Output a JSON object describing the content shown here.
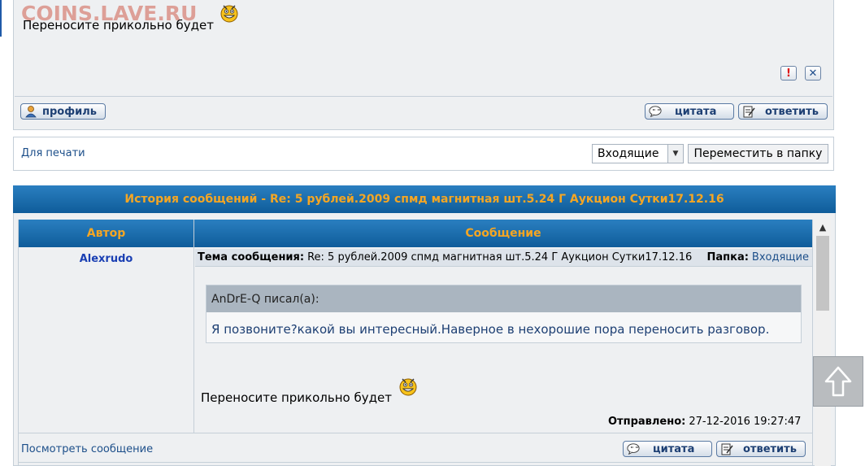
{
  "watermark": "COINS.LAVE.RU",
  "top_post": {
    "text": "Переносите прикольно будет",
    "smiley_icon": "grinning-smiley-icon",
    "report_label": "!",
    "delete_label": "✕",
    "profile_label": "профиль",
    "quote_label": "цитата",
    "reply_label": "ответить"
  },
  "actions": {
    "print_link": "Для печати",
    "folder_selected": "Входящие",
    "move_button": "Переместить в папку"
  },
  "history": {
    "title": "История сообщений - Re: 5 рублей.2009 спмд магнитная шт.5.24 Г Аукцион Сутки17.12.16",
    "col_author": "Автор",
    "col_message": "Сообщение",
    "author": "Alexrudo",
    "subject_label": "Тема сообщения:",
    "subject": "Re: 5 рублей.2009 спмд магнитная шт.5.24 Г Аукцион Сутки17.12.16",
    "folder_label": "Папка:",
    "folder": "Входящие",
    "quote_author": "AnDrE-Q писал(а):",
    "quote_text": "Я позвоните?какой вы интересный.Наверное в нехорошие пора переносить разговор.",
    "message": "Переносите прикольно будет",
    "sent_label": "Отправлено:",
    "sent_value": "27-12-2016 19:27:47",
    "view_link": "Посмотреть сообщение",
    "quote_label": "цитата",
    "reply_label": "ответить"
  },
  "colors": {
    "header_gradient_top": "#2a7fc0",
    "header_gradient_bottom": "#0f5c9a",
    "header_text": "#f5a623",
    "link": "#1d4f8a"
  }
}
